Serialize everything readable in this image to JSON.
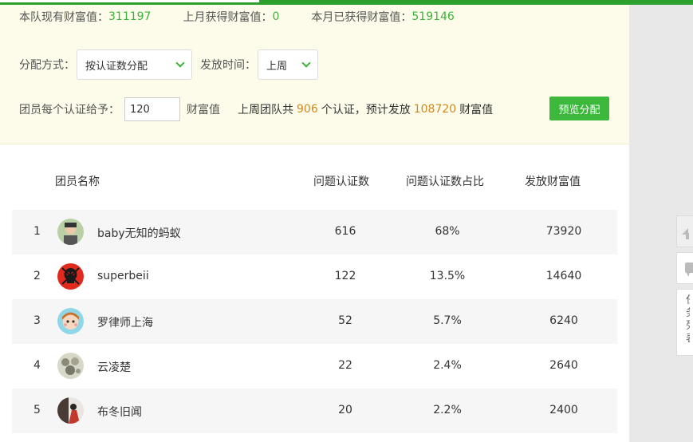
{
  "summary": {
    "team_wealth_label": "本队现有财富值：",
    "team_wealth_value": "311197",
    "last_month_label": "上月获得财富值：",
    "last_month_value": "0",
    "this_month_label": "本月已获得财富值：",
    "this_month_value": "519146"
  },
  "controls": {
    "method_label": "分配方式：",
    "method_value": "按认证数分配",
    "time_label": "发放时间：",
    "time_value": "上周",
    "per_cert_label": "团员每个认证给予：",
    "per_cert_value": "120",
    "per_cert_unit": "财富值",
    "info_prefix": "上周团队共",
    "info_cert_count": "906",
    "info_mid": "个认证，预计发放",
    "info_total": "108720",
    "info_unit": "财富值",
    "preview_button": "预览分配"
  },
  "table": {
    "headers": {
      "name": "团员名称",
      "count": "问题认证数",
      "ratio": "问题认证数占比",
      "wealth": "发放财富值"
    },
    "rows": [
      {
        "idx": "1",
        "name": "baby无知的蚂蚁",
        "count": "616",
        "ratio": "68%",
        "wealth": "73920",
        "avatar": "photo-avatar"
      },
      {
        "idx": "2",
        "name": "superbeii",
        "count": "122",
        "ratio": "13.5%",
        "wealth": "14640",
        "avatar": "skull-avatar"
      },
      {
        "idx": "3",
        "name": "罗律师上海",
        "count": "52",
        "ratio": "5.7%",
        "wealth": "6240",
        "avatar": "cartoon-girl-avatar"
      },
      {
        "idx": "4",
        "name": "云凌楚",
        "count": "22",
        "ratio": "2.4%",
        "wealth": "2640",
        "avatar": "stone-avatar"
      },
      {
        "idx": "5",
        "name": "布冬旧闻",
        "count": "20",
        "ratio": "2.2%",
        "wealth": "2400",
        "avatar": "silhouette-avatar"
      }
    ]
  },
  "sidebar": {
    "feedback_text": "任务列表"
  },
  "colors": {
    "accent_green": "#3bb33b",
    "highlight_orange": "#d08a1e",
    "summary_bg": "#fdfbe9"
  }
}
